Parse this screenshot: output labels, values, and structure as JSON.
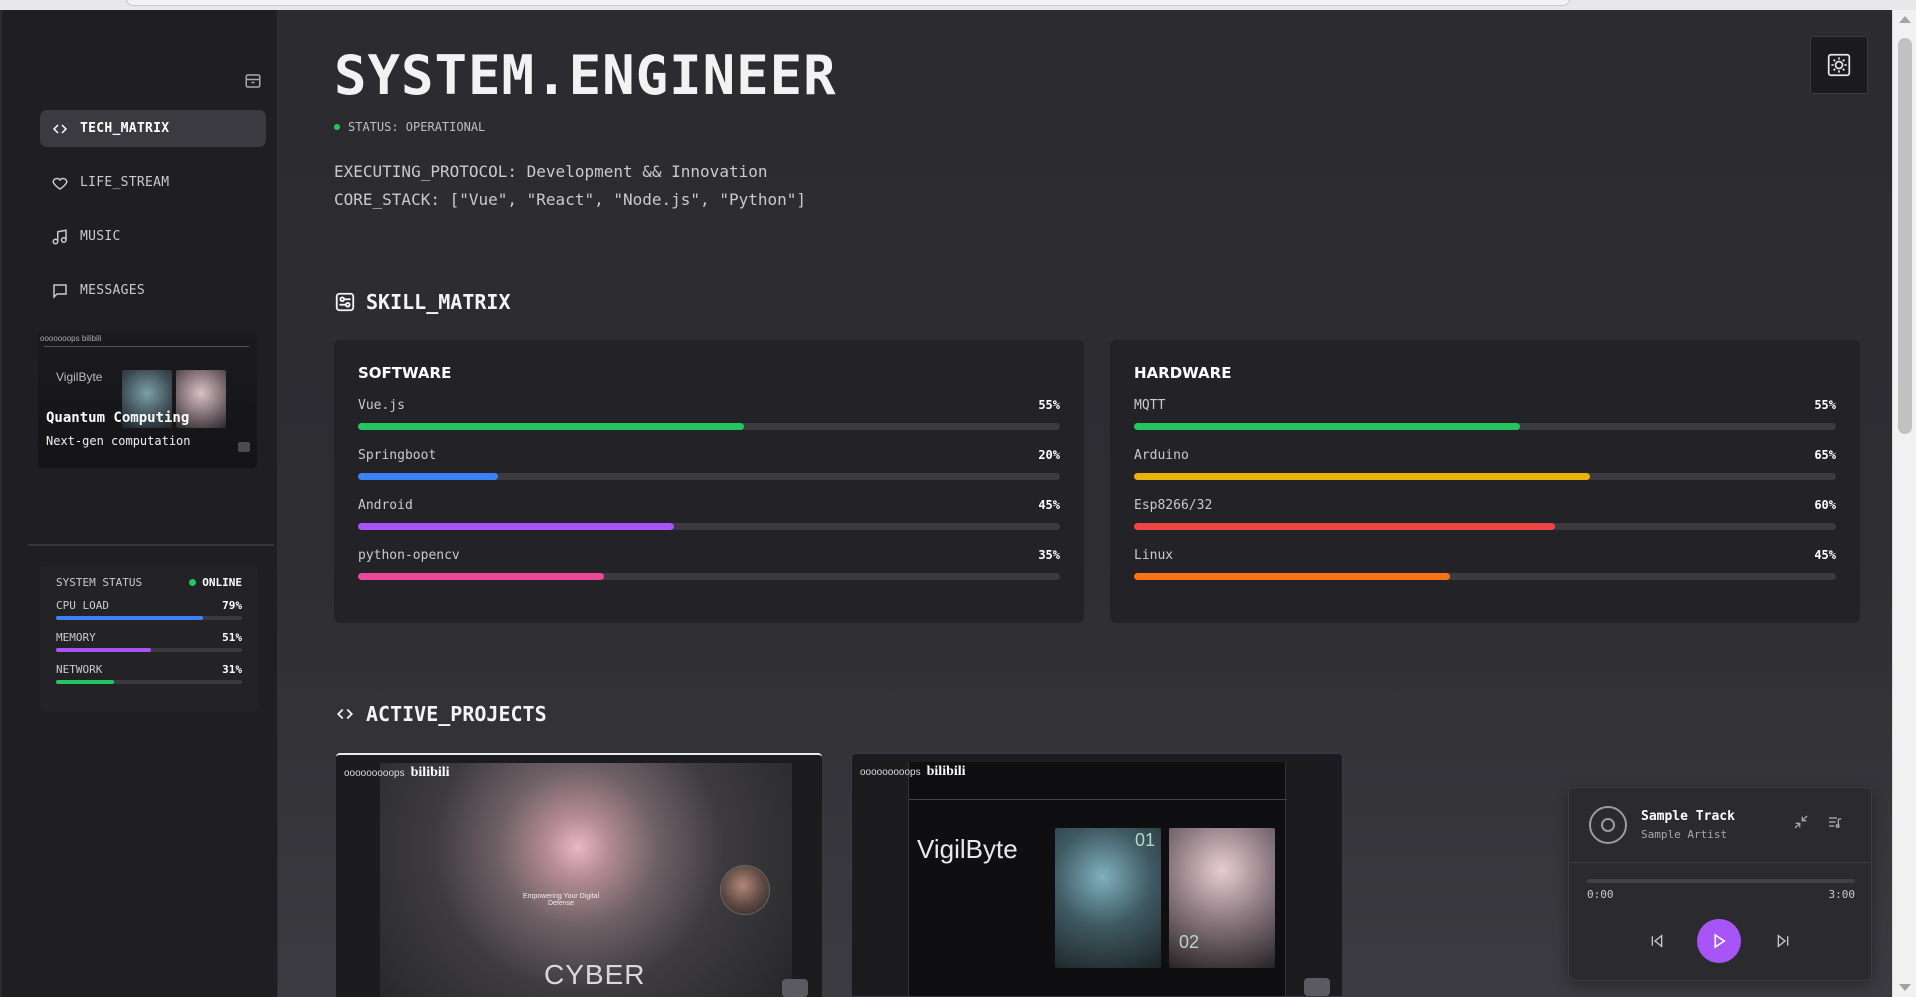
{
  "sidebar": {
    "nav": [
      {
        "label": "TECH_MATRIX",
        "icon": "code-icon",
        "active": true
      },
      {
        "label": "LIFE_STREAM",
        "icon": "heart-icon",
        "active": false
      },
      {
        "label": "MUSIC",
        "icon": "music-note-icon",
        "active": false
      },
      {
        "label": "MESSAGES",
        "icon": "chat-bubble-icon",
        "active": false
      }
    ],
    "preview": {
      "title": "Quantum Computing",
      "subtitle": "Next-gen computation",
      "mini_logo": "VigilByte",
      "mini_top": "ooooooops bilibili"
    },
    "system_status": {
      "title": "SYSTEM STATUS",
      "state": "ONLINE",
      "metrics": [
        {
          "label": "CPU LOAD",
          "value": "79%",
          "level": 0.79,
          "color": "#3b82f6"
        },
        {
          "label": "MEMORY",
          "value": "51%",
          "level": 0.51,
          "color": "#a855f7"
        },
        {
          "label": "NETWORK",
          "value": "31%",
          "level": 0.31,
          "color": "#22c55e"
        }
      ]
    }
  },
  "header": {
    "title": "SYSTEM.ENGINEER",
    "status": "STATUS: OPERATIONAL",
    "protocol_line": "EXECUTING_PROTOCOL: Development && Innovation",
    "stack_line": "CORE_STACK: [\"Vue\", \"React\", \"Node.js\", \"Python\"]"
  },
  "skill_matrix": {
    "heading": "SKILL_MATRIX",
    "software": {
      "title": "SOFTWARE",
      "skills": [
        {
          "name": "Vue.js",
          "value": "55%",
          "level": 0.55,
          "color": "#22c55e"
        },
        {
          "name": "Springboot",
          "value": "20%",
          "level": 0.2,
          "color": "#3b82f6"
        },
        {
          "name": "Android",
          "value": "45%",
          "level": 0.45,
          "color": "#a855f7"
        },
        {
          "name": "python-opencv",
          "value": "35%",
          "level": 0.35,
          "color": "#ec4899"
        }
      ]
    },
    "hardware": {
      "title": "HARDWARE",
      "skills": [
        {
          "name": "MQTT",
          "value": "55%",
          "level": 0.55,
          "color": "#22c55e"
        },
        {
          "name": "Arduino",
          "value": "65%",
          "level": 0.65,
          "color": "#eab308"
        },
        {
          "name": "Esp8266/32",
          "value": "60%",
          "level": 0.6,
          "color": "#ef4444"
        },
        {
          "name": "Linux",
          "value": "45%",
          "level": 0.45,
          "color": "#f97316"
        }
      ]
    }
  },
  "projects": {
    "heading": "ACTIVE_PROJECTS",
    "items": [
      {
        "topbar": "ooooooooops",
        "brand": "bilibili",
        "headline": "CYBER",
        "sub": "Empowering Your Digital Defense"
      },
      {
        "topbar": "ooooooooops",
        "brand": "bilibili",
        "logo": "VigilByte",
        "num1": "01",
        "num2": "02"
      }
    ]
  },
  "player": {
    "track": "Sample Track",
    "artist": "Sample Artist",
    "current_time": "0:00",
    "duration": "3:00",
    "progress": 0,
    "accent": "#a855f7"
  }
}
